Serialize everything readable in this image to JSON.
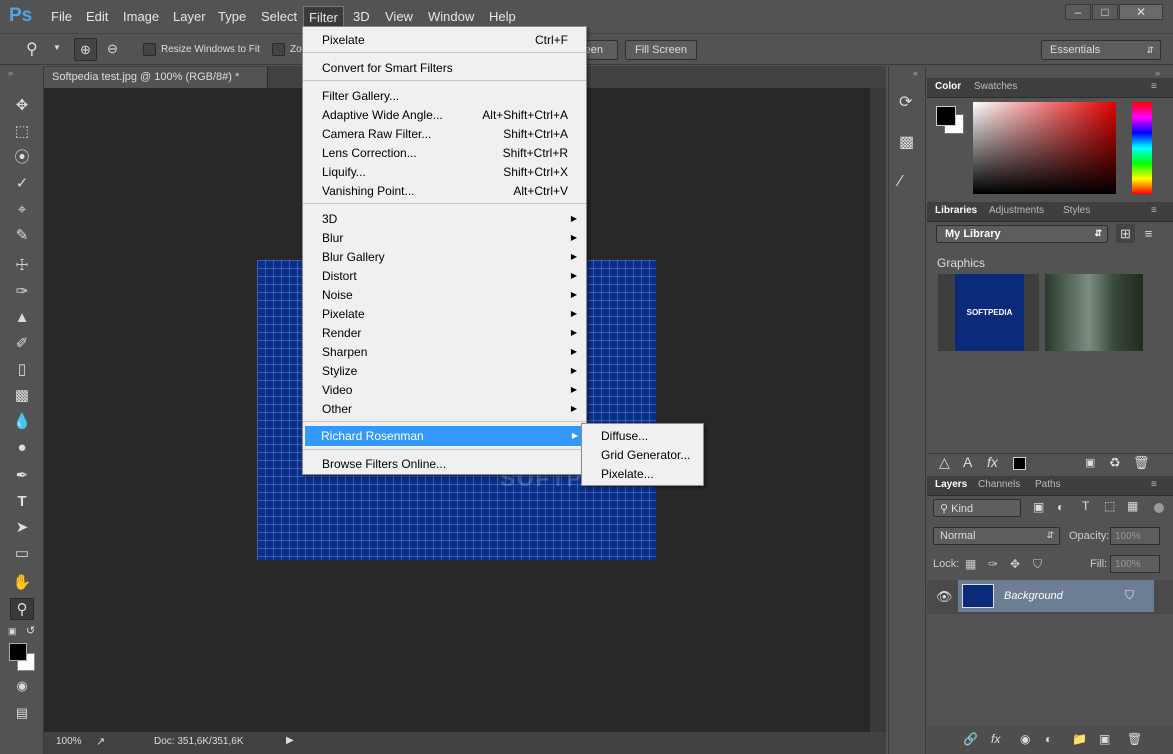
{
  "app": {
    "logo": "Ps"
  },
  "menubar": {
    "items": [
      "File",
      "Edit",
      "Image",
      "Layer",
      "Type",
      "Select",
      "Filter",
      "3D",
      "View",
      "Window",
      "Help"
    ],
    "active": "Filter"
  },
  "window_controls": {
    "minimize": "–",
    "maximize": "□",
    "close": "✕"
  },
  "options_bar": {
    "resize_windows_label": "Resize Windows to Fit",
    "zoom_all_label": "Zo",
    "fit_screen_partial": "een",
    "fill_screen_label": "Fill Screen",
    "workspace_value": "Essentials"
  },
  "document": {
    "tab_title": "Softpedia test.jpg @ 100% (RGB/8#) *",
    "watermark": "SOFTPEDIA"
  },
  "status_bar": {
    "zoom": "100%",
    "doc_info": "Doc: 351,6K/351,6K"
  },
  "filter_menu": {
    "items": [
      {
        "label": "Pixelate",
        "shortcut": "Ctrl+F"
      },
      {
        "label": "Convert for Smart Filters"
      },
      {
        "label": "Filter Gallery..."
      },
      {
        "label": "Adaptive Wide Angle...",
        "shortcut": "Alt+Shift+Ctrl+A"
      },
      {
        "label": "Camera Raw Filter...",
        "shortcut": "Shift+Ctrl+A"
      },
      {
        "label": "Lens Correction...",
        "shortcut": "Shift+Ctrl+R"
      },
      {
        "label": "Liquify...",
        "shortcut": "Shift+Ctrl+X"
      },
      {
        "label": "Vanishing Point...",
        "shortcut": "Alt+Ctrl+V"
      },
      {
        "label": "3D"
      },
      {
        "label": "Blur"
      },
      {
        "label": "Blur Gallery"
      },
      {
        "label": "Distort"
      },
      {
        "label": "Noise"
      },
      {
        "label": "Pixelate"
      },
      {
        "label": "Render"
      },
      {
        "label": "Sharpen"
      },
      {
        "label": "Stylize"
      },
      {
        "label": "Video"
      },
      {
        "label": "Other"
      },
      {
        "label": "Richard Rosenman"
      },
      {
        "label": "Browse Filters Online..."
      }
    ],
    "submenu_arrow": "▶"
  },
  "submenu": {
    "items": [
      "Diffuse...",
      "Grid Generator...",
      "Pixelate..."
    ]
  },
  "color_panel": {
    "tabs": [
      "Color",
      "Swatches"
    ],
    "fg": "#000000",
    "bg": "#ffffff"
  },
  "libraries_panel": {
    "tabs": [
      "Libraries",
      "Adjustments",
      "Styles"
    ],
    "library": "My Library",
    "section": "Graphics",
    "thumb1_text": "SOFTPEDIA"
  },
  "layers_panel": {
    "tabs": [
      "Layers",
      "Channels",
      "Paths"
    ],
    "filter_kind": "Kind",
    "blend_mode": "Normal",
    "opacity_label": "Opacity:",
    "opacity_value": "100%",
    "lock_label": "Lock:",
    "fill_label": "Fill:",
    "fill_value": "100%",
    "layer_name": "Background"
  }
}
